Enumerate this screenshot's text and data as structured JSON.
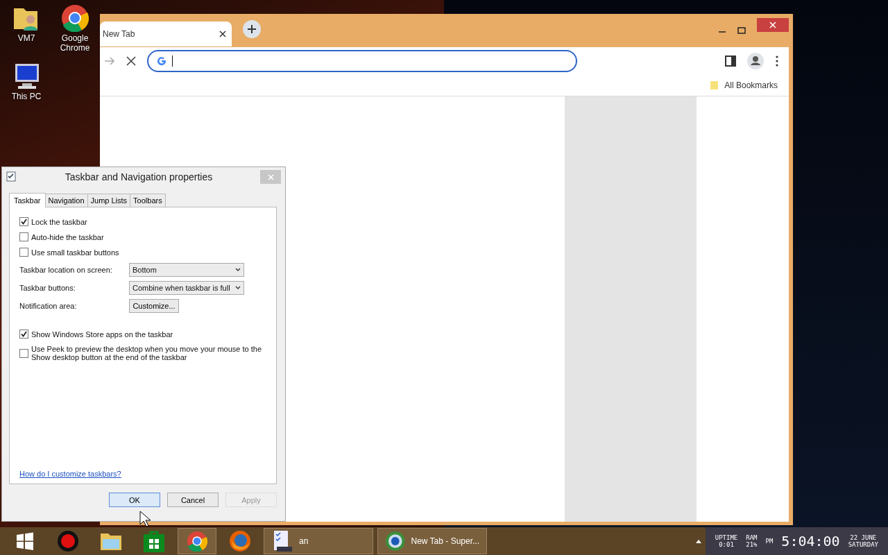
{
  "desktop_icons": [
    {
      "kind": "user-folder",
      "label": "VM7"
    },
    {
      "kind": "chrome",
      "label": "Google Chrome"
    },
    {
      "kind": "computer",
      "label": "This PC"
    }
  ],
  "browser": {
    "tab": {
      "title": "New Tab"
    },
    "bookmarks": [
      "All Bookmarks"
    ]
  },
  "dialog": {
    "title": "Taskbar and Navigation properties",
    "tabs": [
      {
        "label": "Taskbar",
        "selected": true
      },
      {
        "label": "Navigation",
        "selected": false
      },
      {
        "label": "Jump Lists",
        "selected": false
      },
      {
        "label": "Toolbars",
        "selected": false
      }
    ],
    "options_top": [
      {
        "label": "Lock the taskbar",
        "checked": true
      },
      {
        "label": "Auto-hide the taskbar",
        "checked": false
      },
      {
        "label": "Use small taskbar buttons",
        "checked": false
      }
    ],
    "settings": [
      {
        "kind": "dropdown",
        "label": "Taskbar location on screen:",
        "value": "Bottom"
      },
      {
        "kind": "dropdown",
        "label": "Taskbar buttons:",
        "value": "Combine when taskbar is full"
      },
      {
        "kind": "button",
        "label": "Notification area:",
        "value": "Customize..."
      }
    ],
    "options_bottom": [
      {
        "label": "Show Windows Store apps on the taskbar",
        "checked": true
      },
      {
        "label": "Use Peek to preview the desktop when you move your mouse to the Show desktop button at the end of the taskbar",
        "checked": false
      }
    ],
    "help_link": "How do I customize taskbars?",
    "buttons": [
      {
        "label": "OK",
        "disabled": false
      },
      {
        "label": "Cancel",
        "disabled": false
      },
      {
        "label": "Apply",
        "disabled": true
      }
    ]
  },
  "taskbar": {
    "items": [
      {
        "kind": "start",
        "running": false
      },
      {
        "kind": "recorder",
        "running": false
      },
      {
        "kind": "explorer",
        "running": false
      },
      {
        "kind": "store",
        "running": false
      },
      {
        "kind": "chrome",
        "running": true
      },
      {
        "kind": "firefox",
        "running": false
      },
      {
        "kind": "checklist",
        "running": true,
        "label": "an"
      },
      {
        "kind": "browser-globe",
        "running": true,
        "label": "New Tab - Super..."
      }
    ],
    "widget": {
      "uptime_label": "UPTIME",
      "uptime": "0:01",
      "ram_label": "RAM",
      "ram": "21%",
      "ampm": "PM",
      "time": "5:04:00",
      "date": "22 JUNE",
      "weekday": "SATURDAY"
    }
  }
}
